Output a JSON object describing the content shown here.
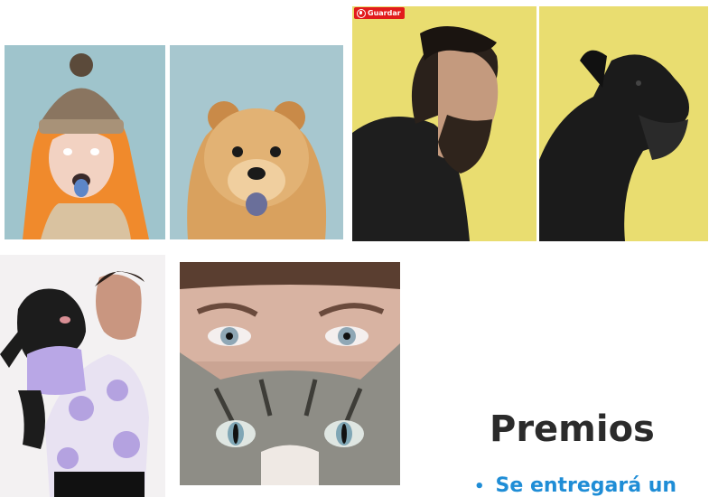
{
  "pin_badge": {
    "label": "Guardar",
    "icon": "pin-icon",
    "color": "#e21b1b"
  },
  "photos": [
    {
      "name": "woman-orange-hair-blue-tongue",
      "background": "#9fc4cc"
    },
    {
      "name": "chow-chow-puppy-blue-tongue",
      "background": "#a7c7cf"
    },
    {
      "name": "bearded-man-profile",
      "background": "#e9dd70"
    },
    {
      "name": "schnauzer-profile",
      "background": "#e9dd70"
    },
    {
      "name": "man-hugging-french-bulldog",
      "background": "#f3f1f2"
    },
    {
      "name": "woman-eyes-over-cat",
      "background": "#8a8c8a"
    }
  ],
  "section": {
    "title": "Premios",
    "bullets": [
      "Se entregará un"
    ],
    "accent_color": "#1f8dd6"
  }
}
